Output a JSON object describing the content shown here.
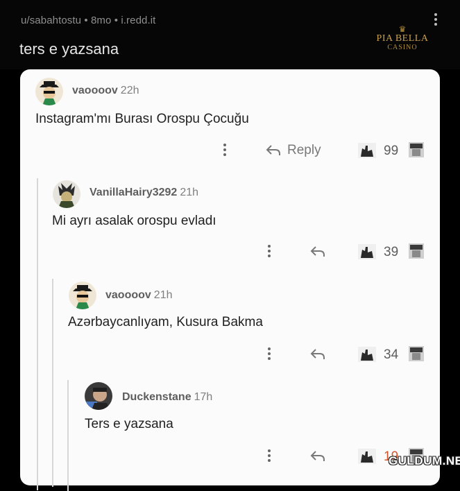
{
  "post": {
    "meta": "u/sabahtostu • 8mo • i.redd.it",
    "title": "ters e yazsana"
  },
  "logo": {
    "crest": "♛",
    "brand": "PIA BELLA",
    "sub": "CASINO"
  },
  "comments": [
    {
      "username": "vaoooov",
      "time": "22h",
      "text": "Instagram'mı Burası Orospu Çocuğu",
      "reply_label": "Reply",
      "votes": "99"
    },
    {
      "username": "VanillaHairy3292",
      "time": "21h",
      "text": "Mi ayrı asalak orospu evladı",
      "reply_label": "",
      "votes": "39"
    },
    {
      "username": "vaoooov",
      "time": "21h",
      "text": "Azərbaycanlıyam, Kusura Bakma",
      "reply_label": "",
      "votes": "34"
    },
    {
      "username": "Duckenstane",
      "time": "17h",
      "text": "Ters e yazsana",
      "reply_label": "",
      "votes": "19"
    }
  ],
  "icons": {
    "more": "more-vertical-icon",
    "reply": "reply-arrow-icon",
    "upvote": "upvote-hand-icon",
    "downvote": "downvote-face-icon"
  },
  "colors": {
    "background": "#000000",
    "card": "#fbfbfb",
    "username": "#5d5d5d",
    "body_text": "#1f1f1f",
    "thread_line": "#d6d6d6",
    "logo_gold": "#c9a050"
  },
  "watermark": "GULDUM.NET"
}
